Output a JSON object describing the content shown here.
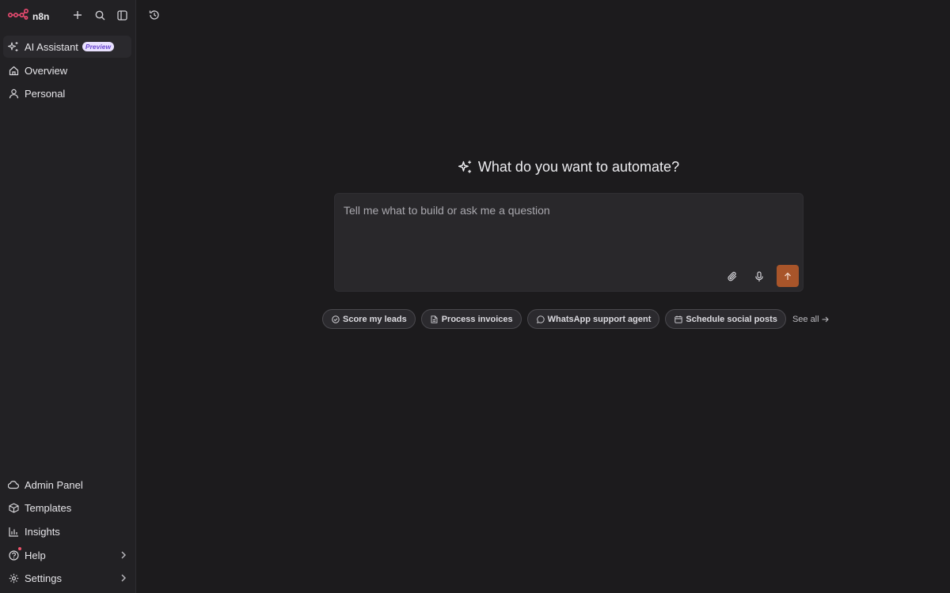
{
  "app": {
    "logo_text": "n8n"
  },
  "sidebar": {
    "top_items": [
      {
        "label": "AI Assistant",
        "badge": "Preview",
        "icon": "sparkles-icon"
      },
      {
        "label": "Overview",
        "icon": "home-icon"
      },
      {
        "label": "Personal",
        "icon": "user-icon"
      }
    ],
    "bottom_items": [
      {
        "label": "Admin Panel",
        "icon": "cloud-icon"
      },
      {
        "label": "Templates",
        "icon": "box-icon"
      },
      {
        "label": "Insights",
        "icon": "bar-chart-icon"
      },
      {
        "label": "Help",
        "icon": "help-circle-icon"
      },
      {
        "label": "Settings",
        "icon": "gear-icon"
      }
    ]
  },
  "main": {
    "headline": "What do you want to automate?",
    "prompt_placeholder": "Tell me what to build or ask me a question",
    "suggestions": [
      {
        "label": "Score my leads",
        "icon": "check-circle-icon"
      },
      {
        "label": "Process invoices",
        "icon": "file-icon"
      },
      {
        "label": "WhatsApp support agent",
        "icon": "chat-bubble-icon"
      },
      {
        "label": "Schedule social posts",
        "icon": "calendar-icon"
      }
    ],
    "see_all_label": "See all"
  },
  "colors": {
    "accent": "#a8552a",
    "logo": "#ea4b71",
    "background": "#1c1b1d",
    "sidebar": "#222124"
  }
}
